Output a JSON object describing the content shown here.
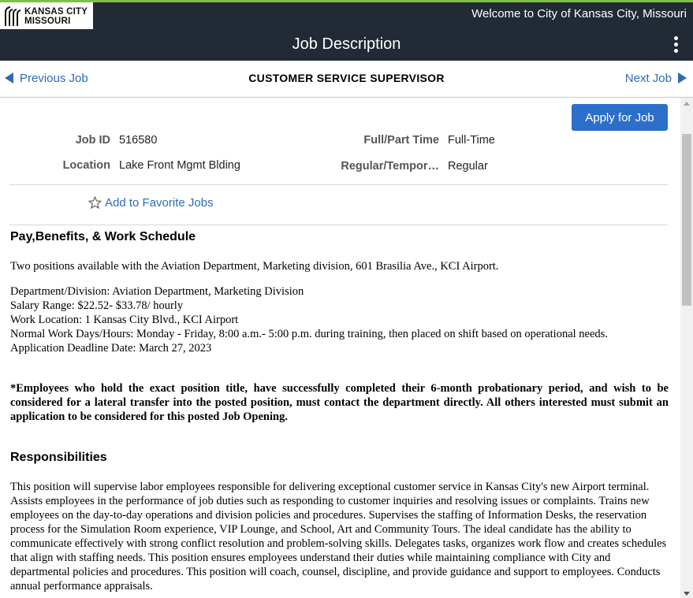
{
  "header": {
    "logo_line1": "KANSAS CITY",
    "logo_line2": "MISSOURI",
    "logo_icon": "city-fountain-logo",
    "welcome": "Welcome to City of Kansas City, Missouri",
    "accent_color": "#7cc142",
    "bar_color": "#222b35"
  },
  "titlebar": {
    "title": "Job Description",
    "menu_icon": "kebab-menu-icon"
  },
  "nav": {
    "prev_label": "Previous Job",
    "next_label": "Next Job",
    "job_title": "CUSTOMER SERVICE SUPERVISOR",
    "link_color": "#2c6cb3"
  },
  "job": {
    "apply_label": "Apply for Job",
    "apply_color": "#2c6fc9",
    "job_id_label": "Job ID",
    "job_id": "516580",
    "location_label": "Location",
    "location": "Lake Front Mgmt Blding",
    "fulltime_label": "Full/Part Time",
    "fulltime": "Full-Time",
    "regular_label": "Regular/Tempor…",
    "regular": "Regular",
    "favorite_label": "Add to Favorite Jobs",
    "favorite_icon": "star-outline-icon"
  },
  "pay": {
    "heading": "Pay,Benefits, & Work Schedule",
    "intro": "Two positions available with the Aviation Department, Marketing division, 601 Brasilia Ave., KCI Airport.",
    "details": [
      "Department/Division: Aviation Department, Marketing Division",
      "Salary Range: $22.52- $33.78/ hourly",
      "Work Location: 1 Kansas City Blvd., KCI Airport",
      "Normal Work Days/Hours: Monday - Friday, 8:00 a.m.- 5:00 p.m. during training, then placed on shift based on operational needs.",
      "Application Deadline Date: March 27, 2023"
    ],
    "notice": "*Employees who hold the exact position title, have successfully completed their 6-month probationary period, and wish to be considered for a lateral transfer into the posted position, must contact the department directly. All others interested must submit an application to be considered for this posted Job Opening."
  },
  "responsibilities": {
    "heading": "Responsibilities",
    "text": "This position will supervise labor employees responsible for delivering exceptional customer service in Kansas City's new Airport terminal. Assists employees in the performance of job duties such as responding to customer inquiries and resolving issues or complaints. Trains new employees on the day-to-day operations and division policies and procedures. Supervises the staffing of Information Desks, the reservation process for the Simulation Room experience, VIP Lounge, and School, Art and Community Tours. The ideal candidate has the ability to communicate effectively with strong conflict resolution and problem-solving skills. Delegates tasks, organizes work flow and creates schedules that align with staffing needs. This position ensures employees understand their duties while maintaining compliance with City and departmental policies and procedures. This position will coach, counsel, discipline, and provide guidance and support to employees. Conducts annual performance appraisals."
  }
}
